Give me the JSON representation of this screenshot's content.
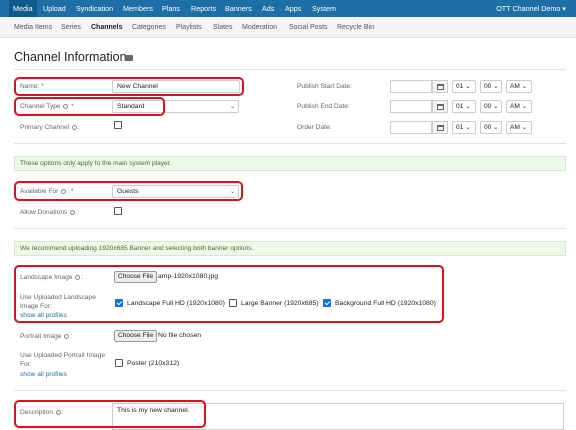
{
  "topnav": {
    "items": [
      "Media",
      "Upload",
      "Syndication",
      "Members",
      "Plans",
      "Reports",
      "Banners",
      "Ads",
      "Apps",
      "System"
    ],
    "account": "OTT Channel Demo ▾"
  },
  "subnav": {
    "items": [
      "Media Items",
      "Series",
      "Channels",
      "Categories",
      "Playlists",
      "Slates",
      "Moderation",
      "Social Posts",
      "Recycle Bin"
    ]
  },
  "page": {
    "title": "Channel Information"
  },
  "form": {
    "name_label": "Name: *",
    "name_value": "New Channel",
    "channel_type_label": "Channel Type",
    "channel_type_req": "*",
    "channel_type_value": "Standard",
    "primary_channel_label": "Primary Channel",
    "publish_start_label": "Publish Start Date:",
    "publish_end_label": "Publish End Date:",
    "order_date_label": "Order Date:",
    "hour": "01",
    "minute": "00",
    "ampm": "AM",
    "system_player_note": "These options only apply to the main system player.",
    "available_for_label": "Available For",
    "available_for_req": "*",
    "available_for_value": "Guests",
    "allow_donations_label": "Allow Donations",
    "banner_note": "We recommend uploading 1920x685 Banner and selecting both banner options.",
    "landscape_image_label": "Landscape Image",
    "choose_file": "Choose File",
    "landscape_file": "amp-1920x1080.jpg",
    "use_landscape_label_1": "Use Uploaded Landscape",
    "use_landscape_label_2": "Image For:",
    "show_all_profiles": "show all profiles",
    "opt_landscape_full": "Landscape Full HD (1920x1080)",
    "opt_large_banner": "Large Banner (1920x685)",
    "opt_background_full": "Background Full HD (1920x1080)",
    "portrait_image_label": "Portrait Image",
    "portrait_file": "No file chosen",
    "use_portrait_label_1": "Use Uploaded Portrait Image",
    "use_portrait_label_2": "For:",
    "opt_poster": "Poster (210x312)",
    "description_label": "Description",
    "description_value": "This is my new channel."
  },
  "colors": {
    "nav_bg": "#1d6fa5",
    "highlight": "#d9121f",
    "note_bg": "#eef8e8"
  }
}
